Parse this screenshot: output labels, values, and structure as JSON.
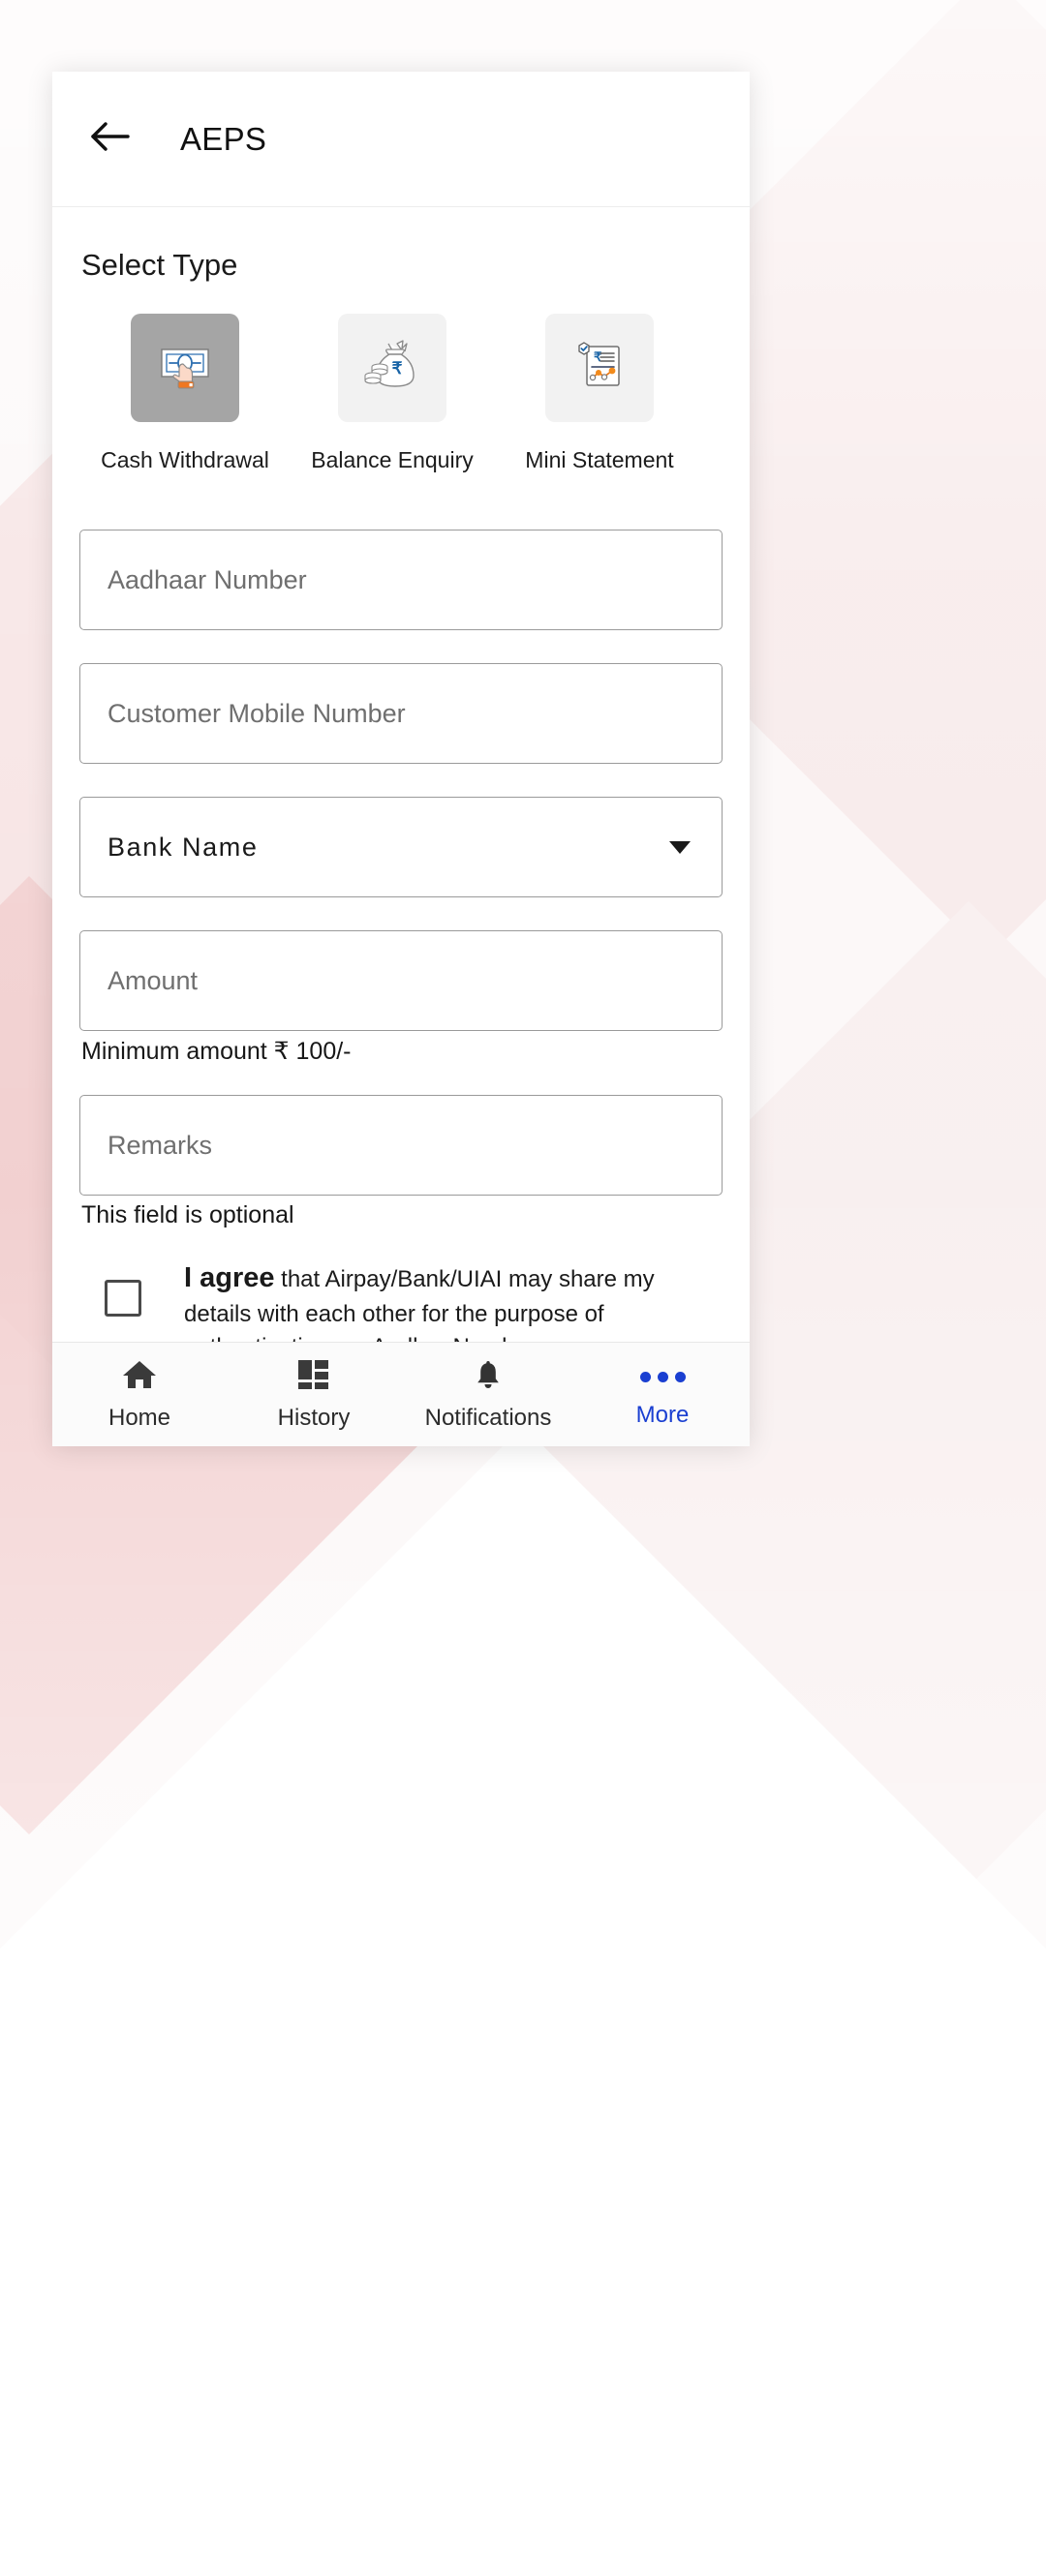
{
  "app": {
    "title": "AEPS",
    "back_icon": "arrow-left-icon"
  },
  "main": {
    "section_title": "Select Type",
    "types": [
      {
        "label": "Cash Withdrawal",
        "icon": "cash-withdrawal-icon",
        "selected": true
      },
      {
        "label": "Balance Enquiry",
        "icon": "money-bag-icon",
        "selected": false
      },
      {
        "label": "Mini Statement",
        "icon": "statement-document-icon",
        "selected": false
      }
    ],
    "fields": {
      "aadhaar_placeholder": "Aadhaar Number",
      "mobile_placeholder": "Customer Mobile Number",
      "bank_value": "Bank Name",
      "bank_caret_icon": "chevron-down-icon",
      "amount_placeholder": "Amount",
      "amount_helper": "Minimum  amount ₹ 100/-",
      "remarks_placeholder": "Remarks",
      "remarks_helper": "This field is optional"
    },
    "consent": {
      "strong": "I agree",
      "rest": " that Airpay/Bank/UIAI may share my details with each other for the purpose of authenticating my Aadhar Number",
      "checked": false
    }
  },
  "bottom_nav": {
    "items": [
      {
        "label": "Home",
        "icon": "home-icon",
        "active": false
      },
      {
        "label": "History",
        "icon": "grid-icon",
        "active": false
      },
      {
        "label": "Notifications",
        "icon": "bell-icon",
        "active": false
      },
      {
        "label": "More",
        "icon": "more-dots-icon",
        "active": true
      }
    ]
  },
  "colors": {
    "accent": "#1a3fd1",
    "selected_tile": "#a5a5a5",
    "tile": "#f2f2f2"
  }
}
